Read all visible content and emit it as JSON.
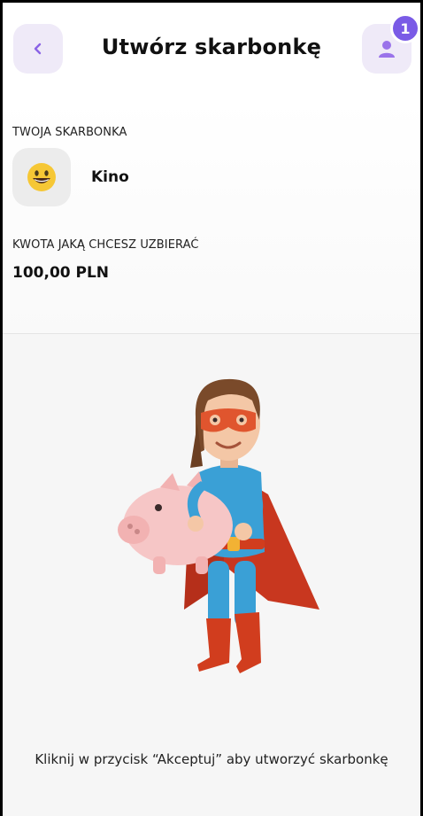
{
  "header": {
    "title": "Utwórz skarbonkę",
    "back_icon": "chevron-left-icon",
    "profile_icon": "user-icon",
    "notification_count": "1"
  },
  "form": {
    "piggy_label": "TWOJA SKARBONKA",
    "piggy_emoji": "😃",
    "piggy_name": "Kino",
    "amount_label": "KWOTA JAKĄ CHCESZ UZBIERAĆ",
    "amount_value": "100,00 PLN"
  },
  "illustration": {
    "icon": "superhero-with-piggy-bank-illustration"
  },
  "info": {
    "text": "Kliknij w przycisk “Akceptuj” aby utworzyć skarbonkę"
  },
  "colors": {
    "accent": "#7a5be6",
    "button_bg": "#efeaf8"
  }
}
